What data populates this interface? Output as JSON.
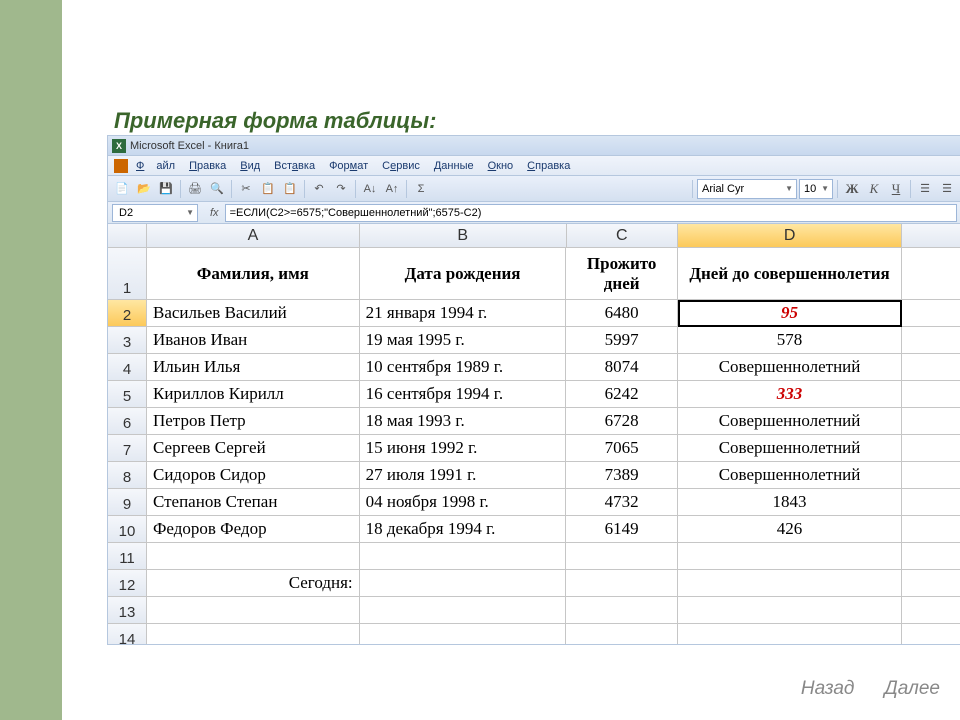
{
  "slide": {
    "title": "Примерная форма таблицы:"
  },
  "window": {
    "app": "Microsoft Excel",
    "doc": "Книга1"
  },
  "menu": [
    "Файл",
    "Правка",
    "Вид",
    "Вставка",
    "Формат",
    "Сервис",
    "Данные",
    "Окно",
    "Справка"
  ],
  "toolbar": {
    "font": "Arial Cyr",
    "size": "10"
  },
  "namebox": "D2",
  "formula": "=ЕСЛИ(C2>=6575;\"Совершеннолетний\";6575-C2)",
  "columns": [
    "A",
    "B",
    "C",
    "D"
  ],
  "headers": {
    "A": "Фамилия, имя",
    "B": "Дата рождения",
    "C": "Прожито дней",
    "D": "Дней до совершеннолетия"
  },
  "rows": [
    {
      "n": "2",
      "a": "Васильев Василий",
      "b": "21 января 1994 г.",
      "c": "6480",
      "d": "95",
      "dred": true
    },
    {
      "n": "3",
      "a": "Иванов Иван",
      "b": "19 мая 1995 г.",
      "c": "5997",
      "d": "578",
      "dred": false
    },
    {
      "n": "4",
      "a": "Ильин Илья",
      "b": "10 сентября 1989 г.",
      "c": "8074",
      "d": "Совершеннолетний",
      "dred": false
    },
    {
      "n": "5",
      "a": "Кириллов Кирилл",
      "b": "16 сентября 1994 г.",
      "c": "6242",
      "d": "333",
      "dred": true
    },
    {
      "n": "6",
      "a": "Петров Петр",
      "b": "18 мая 1993 г.",
      "c": "6728",
      "d": "Совершеннолетний",
      "dred": false
    },
    {
      "n": "7",
      "a": "Сергеев Сергей",
      "b": "15 июня 1992 г.",
      "c": "7065",
      "d": "Совершеннолетний",
      "dred": false
    },
    {
      "n": "8",
      "a": "Сидоров Сидор",
      "b": "27 июля 1991 г.",
      "c": "7389",
      "d": "Совершеннолетний",
      "dred": false
    },
    {
      "n": "9",
      "a": "Степанов Степан",
      "b": "04 ноября 1998 г.",
      "c": "4732",
      "d": "1843",
      "dred": false
    },
    {
      "n": "10",
      "a": "Федоров Федор",
      "b": "18 декабря 1994 г.",
      "c": "6149",
      "d": "426",
      "dred": false
    }
  ],
  "today_label": "Сегодня:",
  "empty_rows": [
    "11",
    "12",
    "13",
    "14"
  ],
  "nav": {
    "back": "Назад",
    "next": "Далее"
  }
}
